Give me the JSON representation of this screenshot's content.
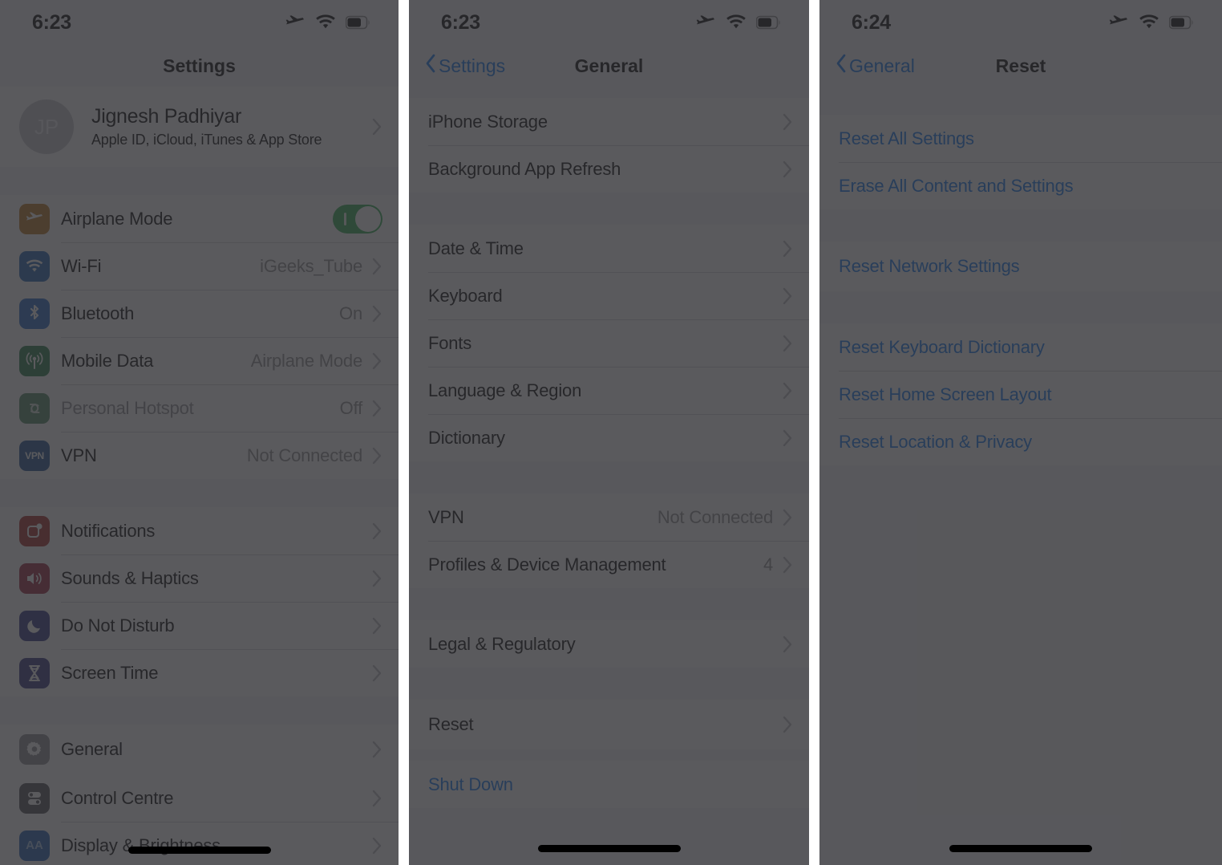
{
  "panels": [
    {
      "id": "settings-panel",
      "status": {
        "time": "6:23",
        "icons": [
          "airplane-icon",
          "wifi-icon",
          "battery-icon"
        ]
      },
      "nav": {
        "title": "Settings",
        "back_label": ""
      },
      "account": {
        "initials": "JP",
        "name": "Jignesh Padhiyar",
        "subtitle": "Apple ID, iCloud, iTunes & App Store"
      },
      "groups": [
        {
          "rows": [
            {
              "label": "Airplane Mode",
              "value": "",
              "icon": "airplane-icon",
              "icon_color": "#b8741a",
              "control": "toggle",
              "toggle_on": true,
              "chevron": false,
              "muted": false
            },
            {
              "label": "Wi-Fi",
              "value": "iGeeks_Tube",
              "icon": "wifi-icon",
              "icon_color": "#1a5fb4",
              "chevron": true,
              "muted": false
            },
            {
              "label": "Bluetooth",
              "value": "On",
              "icon": "bluetooth-icon",
              "icon_color": "#1f66c9",
              "chevron": true,
              "muted": false
            },
            {
              "label": "Mobile Data",
              "value": "Airplane Mode",
              "icon": "cellular-icon",
              "icon_color": "#1f7a40",
              "chevron": true,
              "muted": false
            },
            {
              "label": "Personal Hotspot",
              "value": "Off",
              "icon": "hotspot-icon",
              "icon_color": "#4e8560",
              "chevron": true,
              "muted": true
            },
            {
              "label": "VPN",
              "value": "Not Connected",
              "icon": "vpn-icon",
              "icon_color": "#1a4e8f",
              "chevron": true,
              "muted": false
            }
          ]
        },
        {
          "rows": [
            {
              "label": "Notifications",
              "value": "",
              "icon": "notifications-icon",
              "icon_color": "#a62521",
              "chevron": true,
              "muted": false
            },
            {
              "label": "Sounds & Haptics",
              "value": "",
              "icon": "sounds-icon",
              "icon_color": "#9c1f38",
              "chevron": true,
              "muted": false
            },
            {
              "label": "Do Not Disturb",
              "value": "",
              "icon": "moon-icon",
              "icon_color": "#2c2f80",
              "chevron": true,
              "muted": false
            },
            {
              "label": "Screen Time",
              "value": "",
              "icon": "hourglass-icon",
              "icon_color": "#2f2f7e",
              "chevron": true,
              "muted": false
            }
          ]
        }
      ],
      "highlighted_row": {
        "label": "General",
        "icon": "gear-icon",
        "icon_color": "#8e8e93",
        "chevron": true
      },
      "tail_rows": [
        {
          "label": "Control Centre",
          "value": "",
          "icon": "control-centre-icon",
          "icon_color": "#4b4b50",
          "chevron": true,
          "muted": false
        },
        {
          "label": "Display & Brightness",
          "value": "",
          "icon": "display-brightness-icon",
          "icon_color": "#1b5ab5",
          "chevron": true,
          "muted": false
        }
      ]
    },
    {
      "id": "general-panel",
      "status": {
        "time": "6:23",
        "icons": [
          "airplane-icon",
          "wifi-icon",
          "battery-icon"
        ]
      },
      "nav": {
        "title": "General",
        "back_label": "Settings"
      },
      "groups": [
        {
          "rows": [
            {
              "label": "iPhone Storage",
              "value": "",
              "chevron": true
            },
            {
              "label": "Background App Refresh",
              "value": "",
              "chevron": true
            }
          ]
        },
        {
          "rows": [
            {
              "label": "Date & Time",
              "value": "",
              "chevron": true
            },
            {
              "label": "Keyboard",
              "value": "",
              "chevron": true
            },
            {
              "label": "Fonts",
              "value": "",
              "chevron": true
            },
            {
              "label": "Language & Region",
              "value": "",
              "chevron": true
            },
            {
              "label": "Dictionary",
              "value": "",
              "chevron": true
            }
          ]
        },
        {
          "rows": [
            {
              "label": "VPN",
              "value": "Not Connected",
              "chevron": true
            },
            {
              "label": "Profiles & Device Management",
              "value": "4",
              "chevron": true
            }
          ]
        },
        {
          "rows": [
            {
              "label": "Legal & Regulatory",
              "value": "",
              "chevron": true
            }
          ]
        }
      ],
      "highlighted_row": {
        "label": "Reset",
        "chevron": true
      },
      "tail_rows": [
        {
          "label": "Shut Down",
          "value": "",
          "chevron": false,
          "style": "blue"
        }
      ]
    },
    {
      "id": "reset-panel",
      "status": {
        "time": "6:24",
        "icons": [
          "airplane-icon",
          "wifi-icon",
          "battery-icon"
        ]
      },
      "nav": {
        "title": "Reset",
        "back_label": "General"
      },
      "groups": [
        {
          "rows": [
            {
              "label": "Reset All Settings",
              "style": "blue"
            },
            {
              "label": "Erase All Content and Settings",
              "style": "blue"
            }
          ]
        }
      ],
      "highlighted_row": {
        "label": "Reset Network Settings",
        "style": "blue",
        "chevron": false
      },
      "tail_rows": [
        {
          "label": "Reset Keyboard Dictionary",
          "style": "blue"
        },
        {
          "label": "Reset Home Screen Layout",
          "style": "blue"
        },
        {
          "label": "Reset Location & Privacy",
          "style": "blue"
        }
      ]
    }
  ],
  "colors": {
    "accent_blue": "#0a74f0",
    "toggle_green": "#2aac4d",
    "dim_overlay": "#313134",
    "list_background": "#f2f2f7",
    "row_background": "#ffffff"
  }
}
